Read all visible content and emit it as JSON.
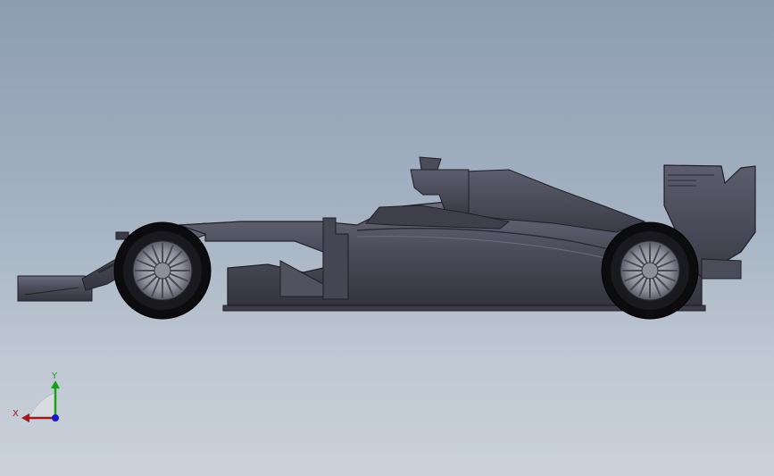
{
  "viewport": {
    "background_top": "#8d9db1",
    "background_bottom": "#cad1da"
  },
  "model": {
    "body_color": "#4a4c5a",
    "tire_color": "#0c0c0e",
    "rim_color": "#9a9aa6"
  },
  "triad": {
    "x_label": "X",
    "y_label": "Y",
    "x_color": "#a01818",
    "y_color": "#18a018",
    "z_color": "#1818c8"
  }
}
